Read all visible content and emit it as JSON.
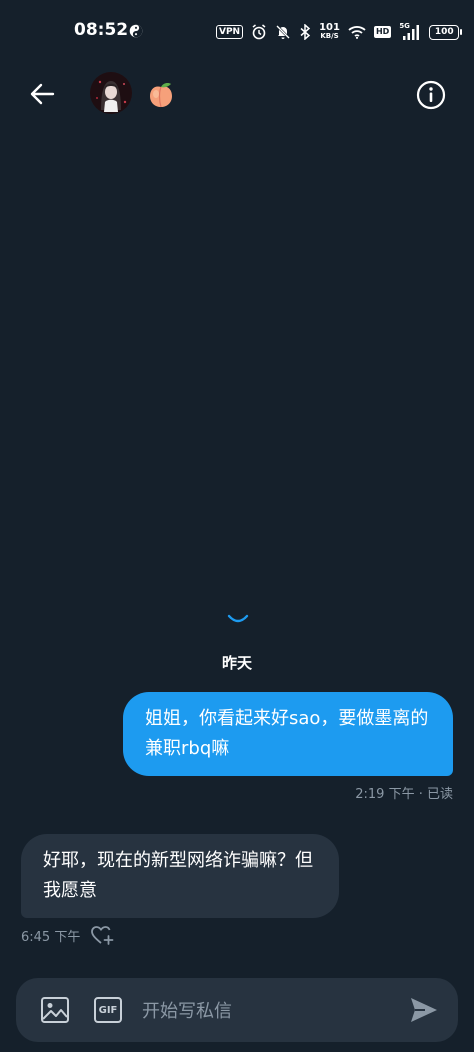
{
  "status_bar": {
    "time": "08:52",
    "vpn": "VPN",
    "net_speed": "101",
    "net_unit": "KB/S",
    "hd": "HD",
    "network": "5G",
    "battery": "100"
  },
  "header": {
    "avatar_icon": "avatar-image",
    "name_emoji": "peach-icon",
    "back_icon": "arrow-left-icon",
    "info_icon": "info-icon"
  },
  "conversation": {
    "day_divider": "昨天",
    "messages": [
      {
        "direction": "outgoing",
        "text": "姐姐，你看起来好sao，要做墨离的兼职rbq嘛",
        "time": "2:19 下午",
        "read_status": "已读"
      },
      {
        "direction": "incoming",
        "text": "好耶，现在的新型网络诈骗嘛？但我愿意",
        "time": "6:45 下午"
      }
    ]
  },
  "composer": {
    "placeholder": "开始写私信",
    "gif_label": "GIF"
  },
  "colors": {
    "background": "#15202b",
    "outgoing_bubble": "#1d9bf0",
    "incoming_bubble": "#273340",
    "meta_text": "#8b98a5"
  }
}
